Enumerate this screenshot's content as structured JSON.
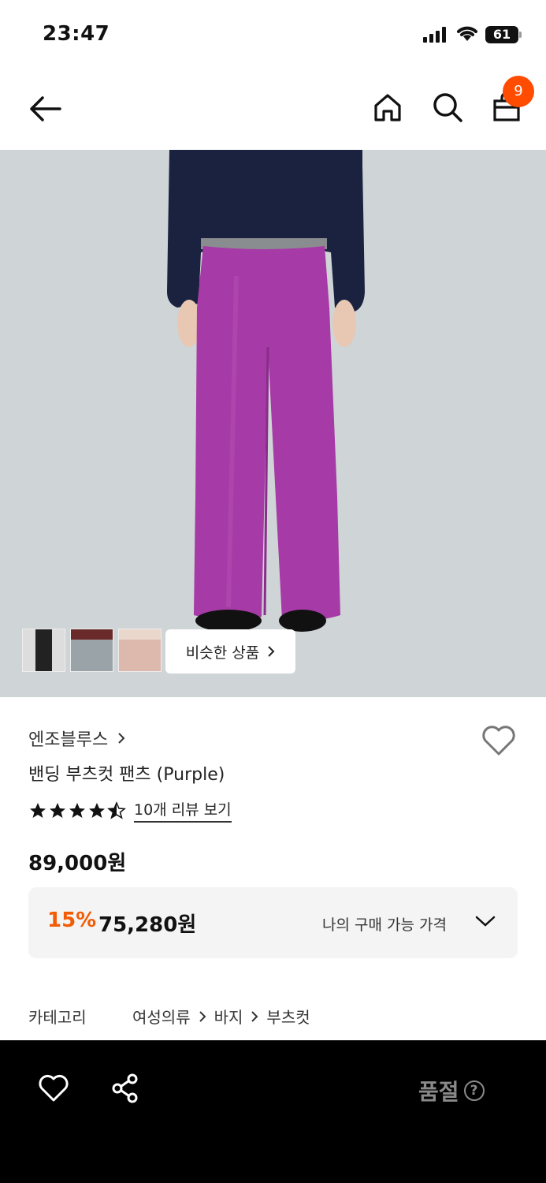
{
  "status_bar": {
    "time": "23:47",
    "battery": "61"
  },
  "header": {
    "cart_badge": "9"
  },
  "gallery": {
    "similar_label": "비슷한 상품",
    "thumbnails": [
      "black-pants",
      "grey-jeans",
      "beige-pants"
    ]
  },
  "product": {
    "brand": "엔조블루스",
    "name": "밴딩 부츠컷 팬츠 (Purple)",
    "rating": 4.5,
    "reviews_label": "10개 리뷰 보기",
    "price": "89,000원",
    "discount": "15%",
    "sale_price": "75,280원",
    "my_price_label": "나의 구매 가능 가격"
  },
  "category": {
    "label": "카테고리",
    "path": [
      "여성의류",
      "바지",
      "부츠컷"
    ]
  },
  "bottom_bar": {
    "soldout_label": "품절",
    "help": "?"
  },
  "colors": {
    "accent": "#f25c05",
    "badge": "#ff4c00",
    "pants": "#a63aa6",
    "background_photo": "#cfd4d6"
  }
}
